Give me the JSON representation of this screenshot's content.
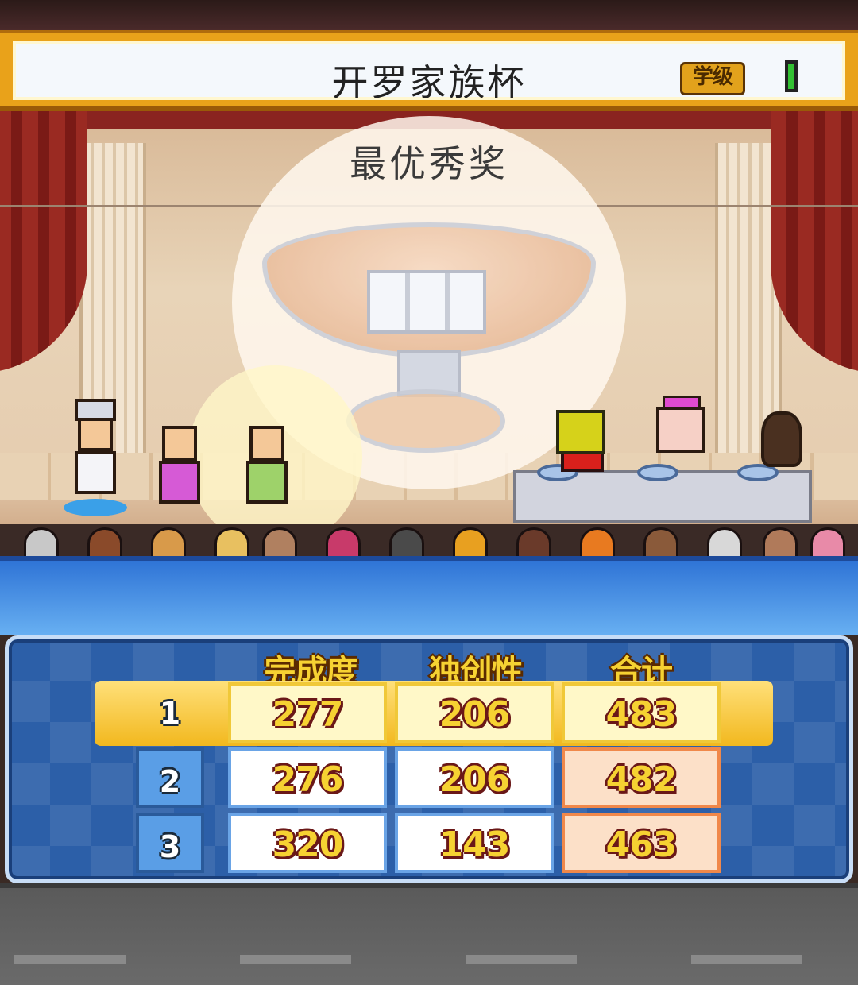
{
  "header": {
    "title": "开罗家族杯",
    "rank_badge": "学级",
    "battery_color": "#33c233"
  },
  "stage": {
    "award_title": "最优秀奖"
  },
  "score_table": {
    "columns": [
      "完成度",
      "独创性",
      "合计"
    ],
    "rows": [
      {
        "rank": "1",
        "completion": "277",
        "originality": "206",
        "total": "483"
      },
      {
        "rank": "2",
        "completion": "276",
        "originality": "206",
        "total": "482"
      },
      {
        "rank": "3",
        "completion": "320",
        "originality": "143",
        "total": "463"
      }
    ]
  },
  "colors": {
    "title_frame": "#e9a21a",
    "panel_blue": "#2c5fa8",
    "score_text": "#f6d232",
    "score_outline": "#6a1818",
    "highlight_row": "#f2b81e",
    "total_cell": "#fce0c8"
  }
}
